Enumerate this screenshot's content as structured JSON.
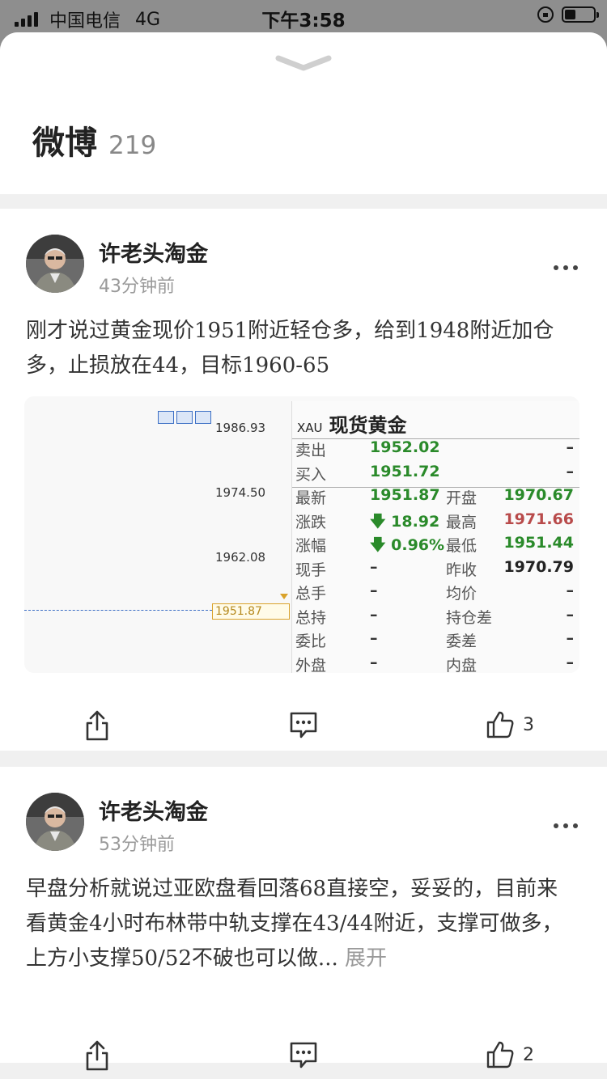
{
  "status_bar": {
    "carrier": "中国电信",
    "network": "4G",
    "time": "下午3:58"
  },
  "header": {
    "title": "微博",
    "count": "219"
  },
  "posts": [
    {
      "author": "许老头淘金",
      "time": "43分钟前",
      "text": "刚才说过黄金现价1951附近轻仓多，给到1948附近加仓多，止损放在44，目标1960-65",
      "like_count": "3",
      "image": {
        "axis_labels": [
          "1986.93",
          "1974.50",
          "1962.08"
        ],
        "current_price_marker": "1951.87",
        "symbol": "XAU",
        "name": "现货黄金",
        "rows": [
          {
            "label": "卖出",
            "value": "1952.02",
            "label2": "",
            "value2": "–",
            "value_color": "#2a8a2a",
            "value2_color": "#333"
          },
          {
            "label": "买入",
            "value": "1951.72",
            "label2": "",
            "value2": "–",
            "value_color": "#2a8a2a",
            "value2_color": "#333"
          },
          {
            "label": "最新",
            "value": "1951.87",
            "label2": "开盘",
            "value2": "1970.67",
            "value_color": "#2a8a2a",
            "value2_color": "#2a8a2a"
          },
          {
            "label": "涨跌",
            "value": "🡇 18.92",
            "label2": "最高",
            "value2": "1971.66",
            "value_color": "#2a8a2a",
            "value2_color": "#b84a4a"
          },
          {
            "label": "涨幅",
            "value": "🡇 0.96%",
            "label2": "最低",
            "value2": "1951.44",
            "value_color": "#2a8a2a",
            "value2_color": "#2a8a2a"
          },
          {
            "label": "现手",
            "value": "–",
            "label2": "昨收",
            "value2": "1970.79",
            "value_color": "#333",
            "value2_color": "#222"
          },
          {
            "label": "总手",
            "value": "–",
            "label2": "均价",
            "value2": "–",
            "value_color": "#333",
            "value2_color": "#333"
          },
          {
            "label": "总持",
            "value": "–",
            "label2": "持仓差",
            "value2": "–",
            "value_color": "#333",
            "value2_color": "#333"
          },
          {
            "label": "委比",
            "value": "–",
            "label2": "委差",
            "value2": "–",
            "value_color": "#333",
            "value2_color": "#333"
          },
          {
            "label": "外盘",
            "value": "–",
            "label2": "内盘",
            "value2": "–",
            "value_color": "#333",
            "value2_color": "#333"
          }
        ]
      }
    },
    {
      "author": "许老头淘金",
      "time": "53分钟前",
      "text": "早盘分析就说过亚欧盘看回落68直接空，妥妥的，目前来看黄金4小时布林带中轨支撑在43/44附近，支撑可做多，上方小支撑50/52不破也可以做...",
      "expand_label": "展开",
      "like_count": "2"
    }
  ],
  "icons": {
    "share": "share-icon",
    "comment": "comment-icon",
    "like": "thumbs-up-icon",
    "more": "more-icon",
    "collapse": "chevron-down-icon"
  }
}
